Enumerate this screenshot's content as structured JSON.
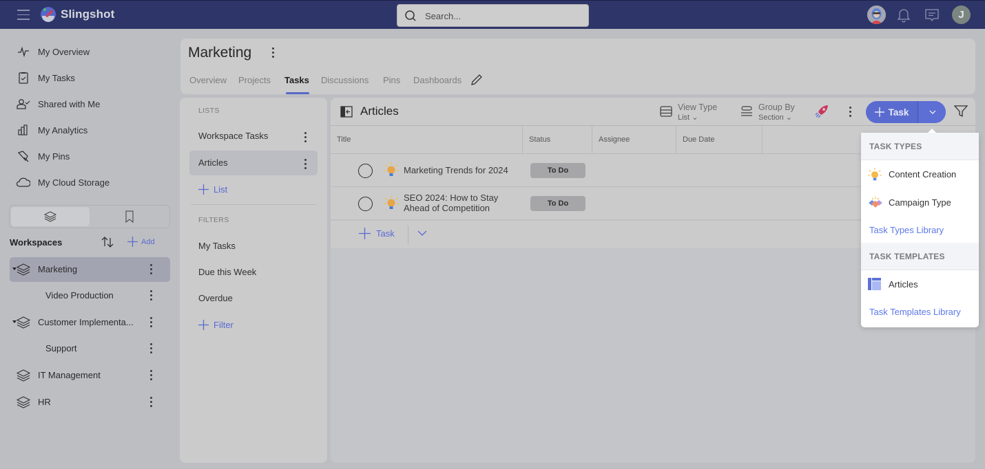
{
  "topbar": {
    "brand": "Slingshot",
    "search_placeholder": "Search...",
    "user_initial": "J",
    "icons": [
      "menu-icon",
      "slingshot-logo",
      "search-icon",
      "user-avatar",
      "bell-icon",
      "chat-icon"
    ]
  },
  "sidebar": {
    "nav": [
      {
        "label": "My Overview",
        "icon": "activity-icon"
      },
      {
        "label": "My Tasks",
        "icon": "clipboard-check-icon"
      },
      {
        "label": "Shared with Me",
        "icon": "user-check-icon"
      },
      {
        "label": "My Analytics",
        "icon": "bar-chart-icon"
      },
      {
        "label": "My Pins",
        "icon": "pin-icon"
      },
      {
        "label": "My Cloud Storage",
        "icon": "cloud-icon"
      }
    ],
    "segment": [
      {
        "icon": "layers-icon",
        "active": true
      },
      {
        "icon": "bookmark-icon",
        "active": false
      }
    ],
    "workspaces_label": "Workspaces",
    "add_label": "Add",
    "workspaces": [
      {
        "label": "Marketing",
        "level": 0,
        "expanded": true,
        "active": true
      },
      {
        "label": "Video Production",
        "level": 1
      },
      {
        "label": "Customer Implementa...",
        "level": 0,
        "expanded": true
      },
      {
        "label": "Support",
        "level": 1
      },
      {
        "label": "IT Management",
        "level": 0
      },
      {
        "label": "HR",
        "level": 0
      }
    ]
  },
  "header": {
    "title": "Marketing",
    "tabs": [
      {
        "label": "Overview"
      },
      {
        "label": "Projects"
      },
      {
        "label": "Tasks",
        "active": true
      },
      {
        "label": "Discussions"
      },
      {
        "label": "Pins"
      },
      {
        "label": "Dashboards"
      }
    ]
  },
  "lists_panel": {
    "lists_label": "LISTS",
    "lists": [
      {
        "label": "Workspace Tasks"
      },
      {
        "label": "Articles",
        "active": true
      }
    ],
    "add_list_label": "List",
    "filters_label": "FILTERS",
    "filters": [
      "My Tasks",
      "Due this Week",
      "Overdue"
    ],
    "add_filter_label": "Filter"
  },
  "main": {
    "title": "Articles",
    "view_type": {
      "label": "View Type",
      "value": "List"
    },
    "group_by": {
      "label": "Group By",
      "value": "Section"
    },
    "task_button": "Task",
    "columns": [
      "Title",
      "Status",
      "Assignee",
      "Due Date"
    ],
    "rows": [
      {
        "title_line1": "Marketing Trends for 2024",
        "title_line2": "",
        "status": "To Do",
        "assignee": "",
        "due": ""
      },
      {
        "title_line1": "SEO 2024: How to Stay",
        "title_line2": "Ahead of Competition",
        "status": "To Do",
        "assignee": "",
        "due": ""
      }
    ],
    "add_task_label": "Task"
  },
  "popover": {
    "task_types_label": "TASK TYPES",
    "task_types": [
      {
        "label": "Content Creation",
        "icon": "lightbulb-icon"
      },
      {
        "label": "Campaign Type",
        "icon": "handshake-icon"
      }
    ],
    "task_types_library": "Task Types Library",
    "task_templates_label": "TASK TEMPLATES",
    "task_templates": [
      {
        "label": "Articles",
        "icon": "template-icon"
      }
    ],
    "task_templates_library": "Task Templates Library"
  },
  "colors": {
    "topbar": "#2e3568",
    "accent": "#5a6bd0",
    "link": "#5d78e8",
    "status_todo": "#a6a6a8"
  }
}
